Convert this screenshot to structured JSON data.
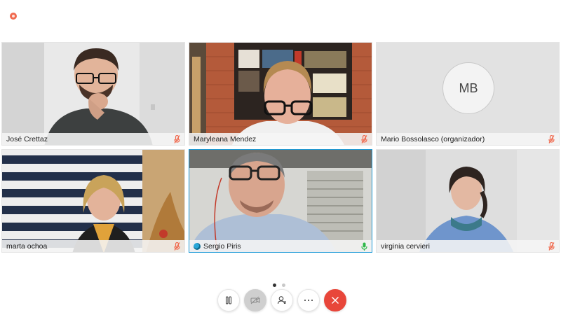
{
  "participants": [
    {
      "name": "José Crettaz",
      "mic": "muted"
    },
    {
      "name": "Maryleana Mendez",
      "mic": "muted"
    },
    {
      "name": "Mario Bossolasco (organizador)",
      "mic": "muted",
      "initials": "MB"
    },
    {
      "name": "marta ochoa",
      "mic": "muted"
    },
    {
      "name": "Sergio Piris",
      "mic": "active"
    },
    {
      "name": "virginia cervieri",
      "mic": "muted"
    }
  ],
  "icons": {
    "record": "record-indicator-icon",
    "mute": "mic-muted-icon",
    "active_mic": "mic-active-icon",
    "mute_button": "mute-icon",
    "video_button": "video-off-icon",
    "participants_button": "participants-icon",
    "more_button": "more-icon",
    "end_button": "end-call-icon"
  },
  "colors": {
    "accent": "#1e9bd7",
    "end_call": "#e8463a",
    "muted": "#f06a4f",
    "active_mic": "#2eb84a"
  },
  "pager": {
    "pages": 2,
    "current": 1
  }
}
